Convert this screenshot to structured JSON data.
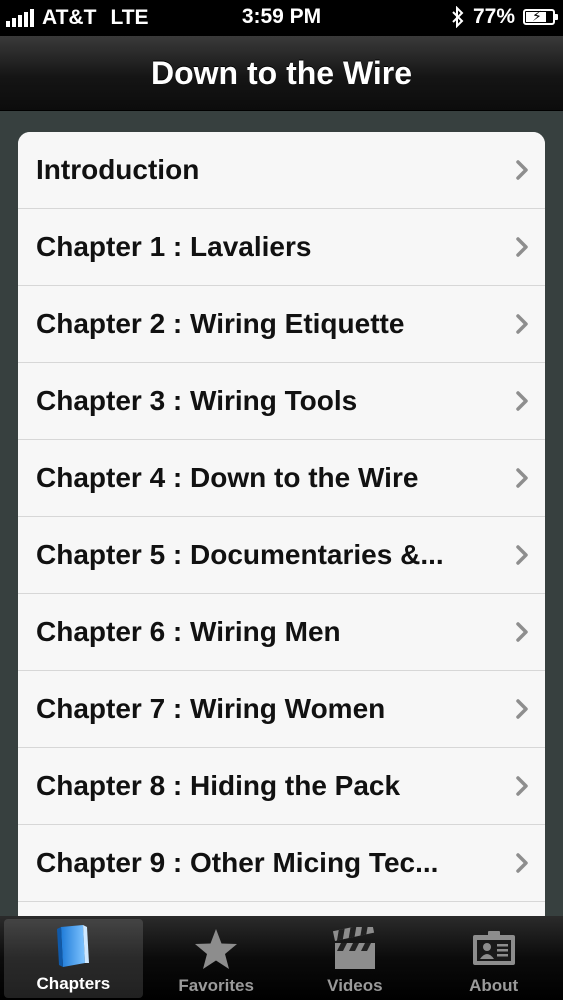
{
  "status_bar": {
    "carrier": "AT&T",
    "network": "LTE",
    "time": "3:59 PM",
    "battery_percent": "77%",
    "battery_level": 0.77,
    "icons": [
      "signal-bars-icon",
      "bluetooth-icon",
      "battery-charging-icon"
    ]
  },
  "nav": {
    "title": "Down to the Wire"
  },
  "chapters": [
    {
      "label": "Introduction"
    },
    {
      "label": "Chapter 1 : Lavaliers"
    },
    {
      "label": "Chapter 2 : Wiring Etiquette"
    },
    {
      "label": "Chapter 3 : Wiring Tools"
    },
    {
      "label": "Chapter 4 : Down to the Wire"
    },
    {
      "label": "Chapter 5 : Documentaries &..."
    },
    {
      "label": "Chapter 6 : Wiring Men"
    },
    {
      "label": "Chapter 7 : Wiring Women"
    },
    {
      "label": "Chapter 8 : Hiding the Pack"
    },
    {
      "label": "Chapter 9 : Other Micing Tec..."
    },
    {
      "label": ""
    }
  ],
  "tabs": [
    {
      "label": "Chapters",
      "icon": "book-icon",
      "selected": true
    },
    {
      "label": "Favorites",
      "icon": "star-icon",
      "selected": false
    },
    {
      "label": "Videos",
      "icon": "clapperboard-icon",
      "selected": false
    },
    {
      "label": "About",
      "icon": "id-card-icon",
      "selected": false
    }
  ],
  "colors": {
    "nav_background": "#1a1a1a",
    "table_background": "#f7f7f7",
    "page_background": "#37403f",
    "chevron": "#8e8e8e"
  }
}
